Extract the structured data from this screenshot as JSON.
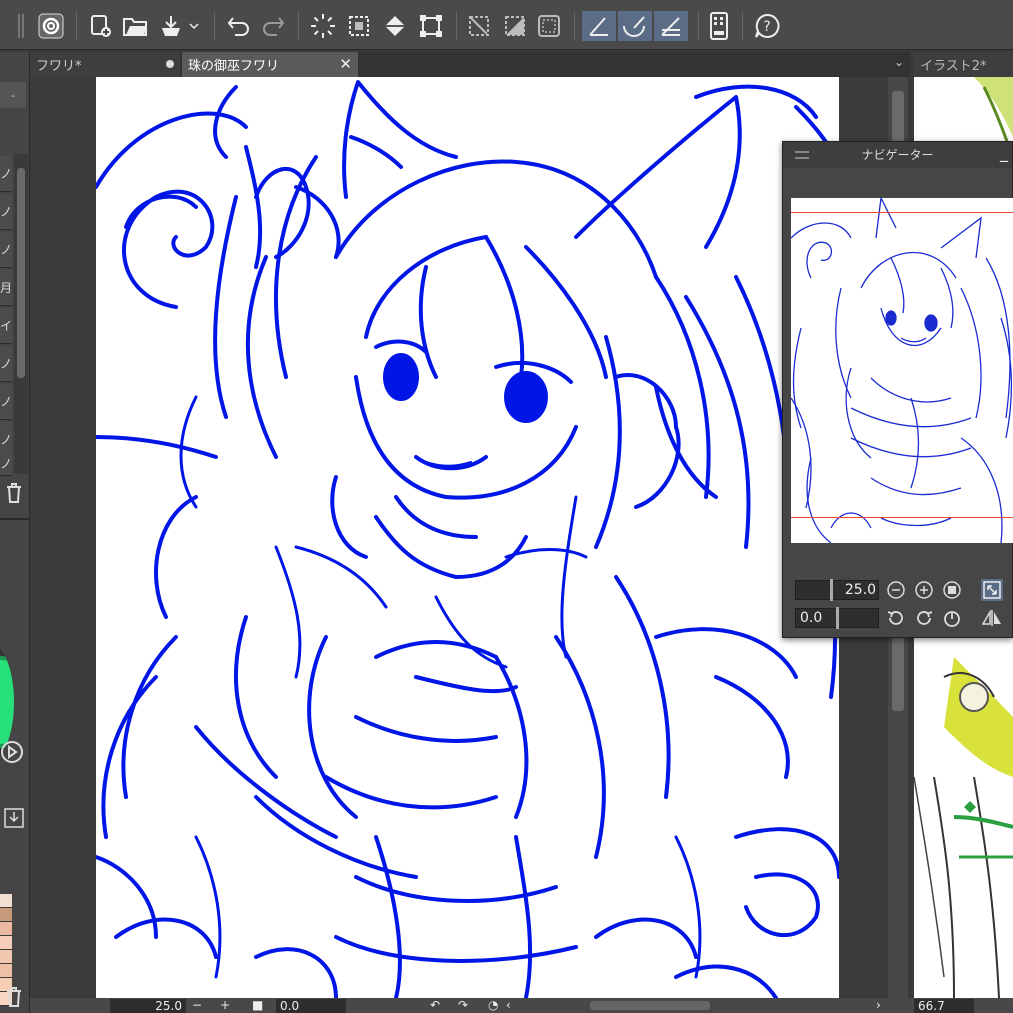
{
  "toolbar": {
    "icons": [
      "app-logo-icon",
      "new-file-icon",
      "open-folder-icon",
      "export-icon",
      "chevron-down-icon",
      "undo-icon",
      "redo-icon",
      "loading-icon",
      "selection-dotted-icon",
      "fill-icon",
      "transform-icon",
      "deselect-icon",
      "invert-selection-icon",
      "selection-border-icon",
      "ruler-snap-icon",
      "special-ruler-snap-icon",
      "grid-snap-icon",
      "tablet-icon",
      "help-icon"
    ]
  },
  "tabs": {
    "inactive_label": "フワリ*",
    "active_label": "珠の御巫フワリ",
    "right_label": "イラスト2*"
  },
  "navigator": {
    "title": "ナビゲーター",
    "zoom_value": "25.0",
    "rotate_value": "0.0"
  },
  "bottom": {
    "zoom_value": "25.0",
    "rotate_value": "0.0",
    "subview_zoom": "66.7"
  },
  "left_panel": {
    "row_labels": [
      "ノ",
      "ノ",
      "ノ",
      "月",
      "イ",
      "ノ",
      "ノ",
      "ノ",
      "ノ"
    ]
  },
  "colors": {
    "lineart": "#0016e6",
    "accent_selected": "#5b6d86",
    "navigator_frame": "#e43333",
    "color_wheel": "#27e07a"
  }
}
